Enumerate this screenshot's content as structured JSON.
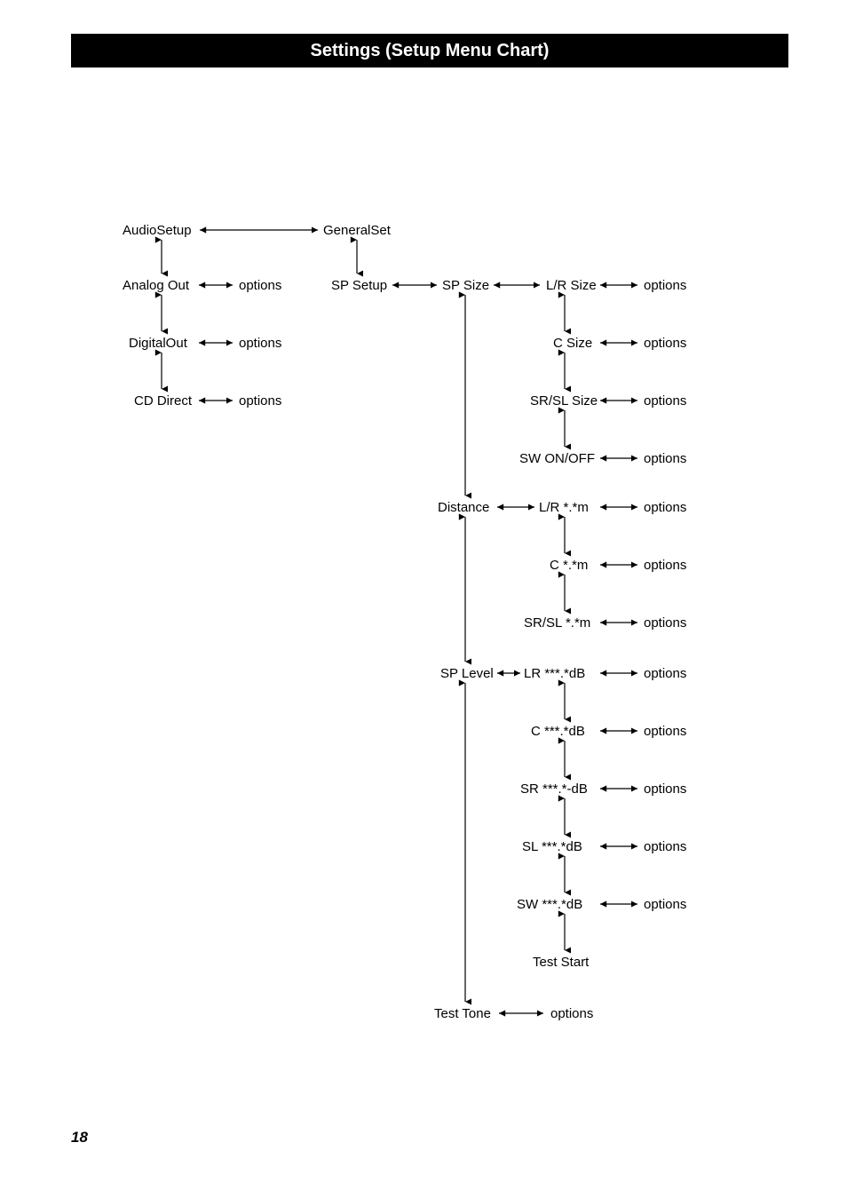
{
  "header": {
    "title": "Settings (Setup Menu Chart)"
  },
  "page": {
    "number": "18"
  },
  "labels": {
    "audioSetup": "AudioSetup",
    "generalSet": "GeneralSet",
    "analogOut": "Analog Out",
    "digitalOut": "DigitalOut",
    "cdDirect": "CD Direct",
    "spSetup": "SP Setup",
    "spSize": "SP Size",
    "lrSize": "L/R Size",
    "cSize": "C Size",
    "srslSize": "SR/SL Size",
    "swOnOff": "SW ON/OFF",
    "distance": "Distance",
    "lrDist": "L/R  *.*m",
    "cDist": "C  *.*m",
    "srslDist": "SR/SL *.*m",
    "spLevel": "SP Level",
    "lrDb": "LR ***.*dB",
    "cDb": "C ***.*dB",
    "srDb": "SR ***.*-dB",
    "slDb": "SL ***.*dB",
    "swDb": "SW ***.*dB",
    "testStart": "Test Start",
    "testTone": "Test Tone",
    "options": "options"
  }
}
